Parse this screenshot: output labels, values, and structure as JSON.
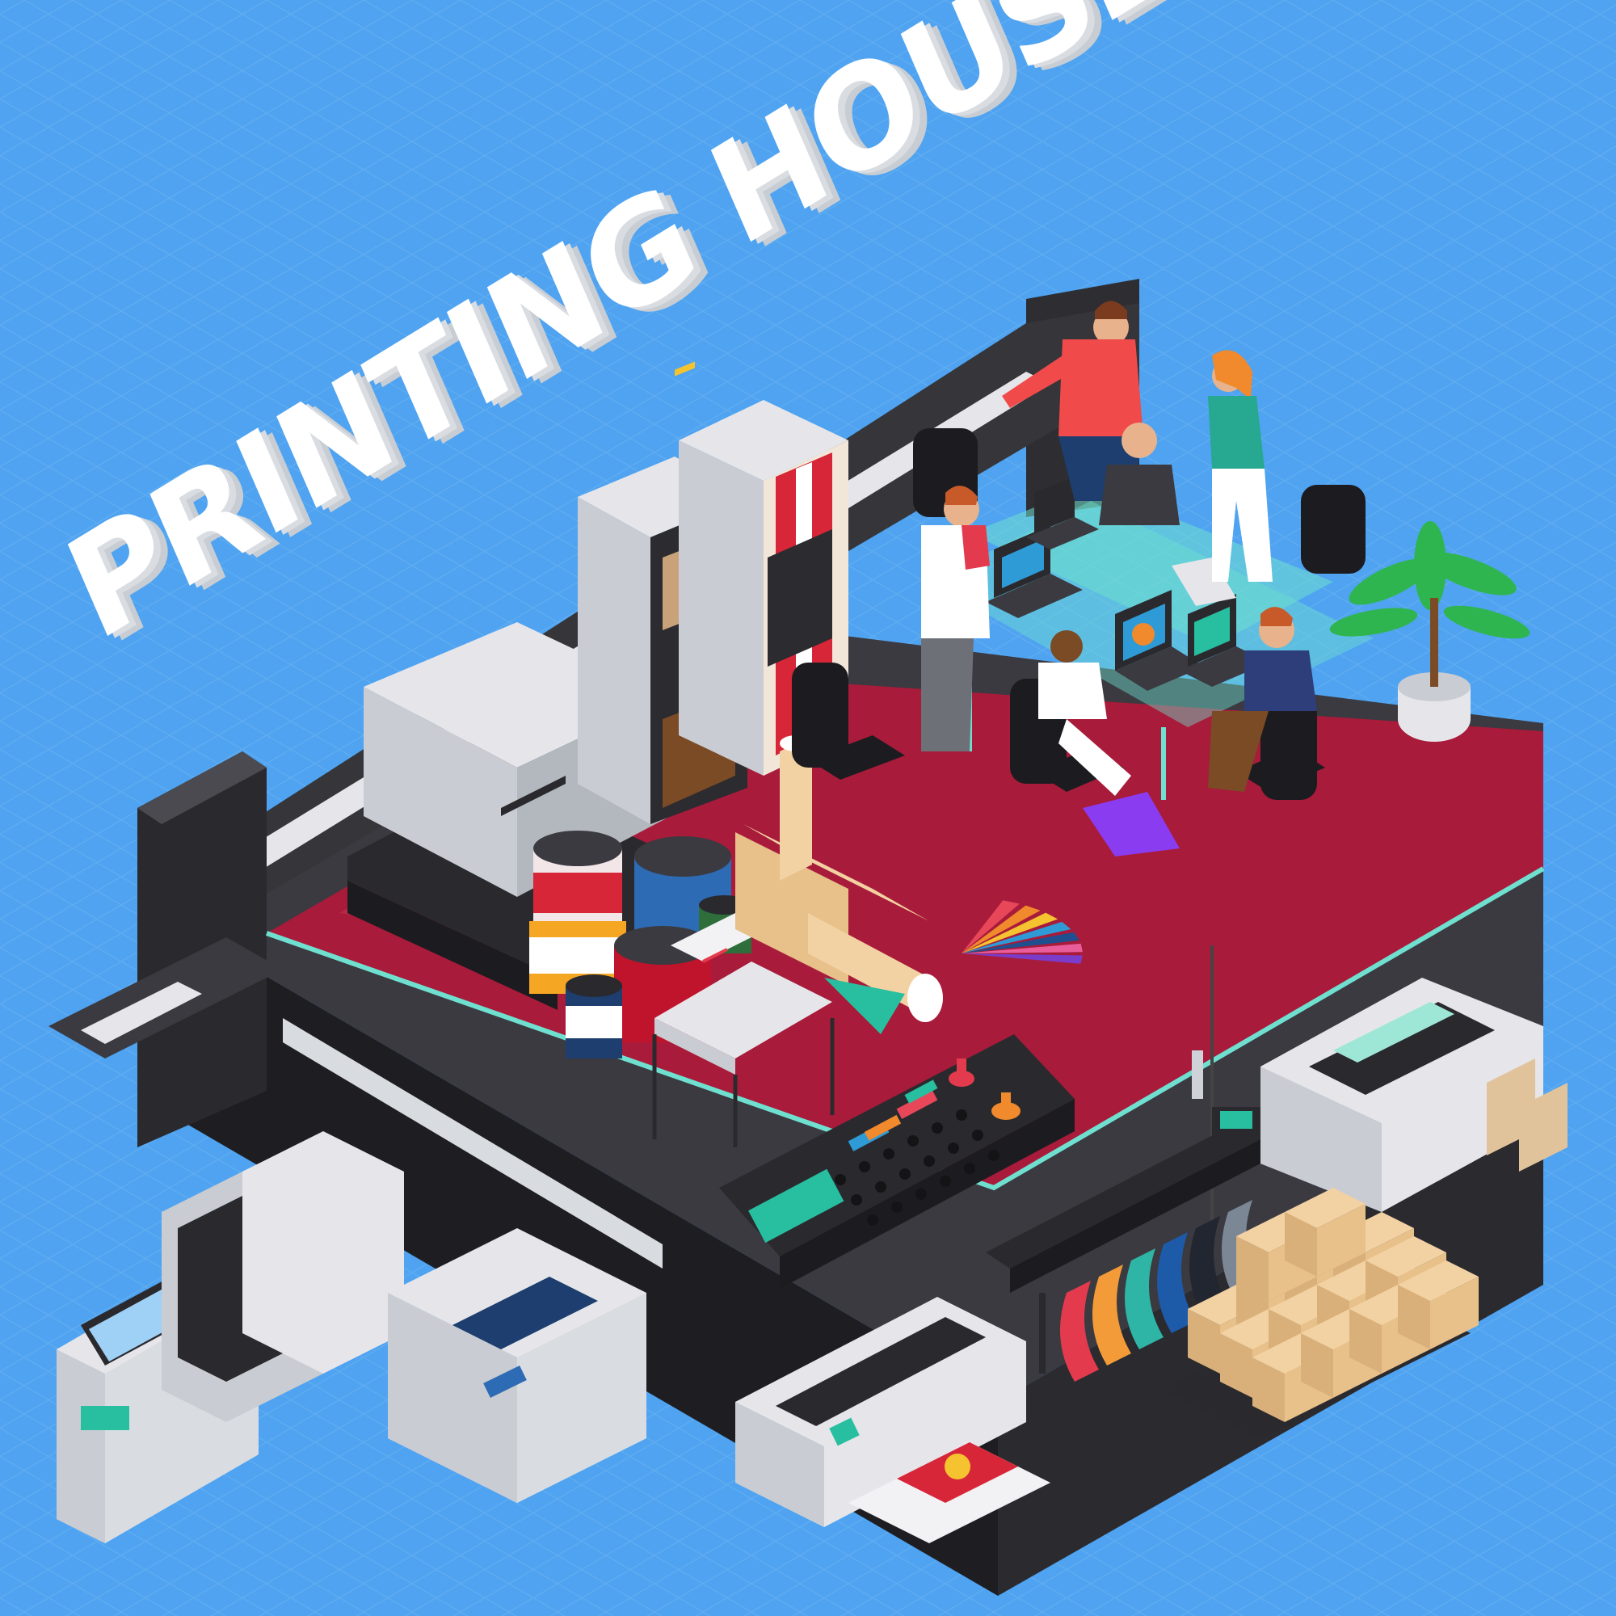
{
  "title": {
    "text": "PRINTING HOUSE"
  },
  "colors": {
    "background": "#4fa3f0",
    "grid": "#6bb3f2",
    "title_face": "#ffffff",
    "title_side": "#c8cdd3",
    "machine_dark": "#2b2b2f",
    "floor": "#a81b3a",
    "glass": "#6fe0cf"
  },
  "scene": {
    "people_count": 6,
    "laptops_count": 5,
    "paint_cans_count": 5,
    "boxes_on_pallet": 14,
    "color_swatch_colors": [
      "#e8475a",
      "#f08a2c",
      "#f5c330",
      "#2e9bd6",
      "#1f4f8f",
      "#e85d9a",
      "#7a3cc9"
    ],
    "banner_stripe_colors": [
      "#e33b4d",
      "#f29b38",
      "#2fb5a6",
      "#1d5aa8",
      "#222631",
      "#7b8794"
    ]
  }
}
